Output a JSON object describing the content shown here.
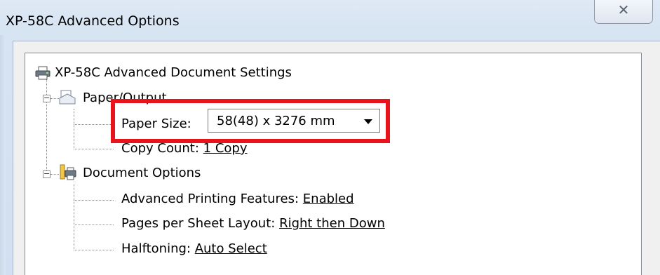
{
  "window": {
    "title": "XP-58C Advanced Options",
    "close_glyph": "✕"
  },
  "tree": {
    "root": {
      "label": "XP-58C Advanced Document Settings",
      "icon": "printer-icon"
    },
    "paper_output": {
      "label": "Paper/Output",
      "icon": "paper-output-icon",
      "expander": "−",
      "paper_size": {
        "label": "Paper Size:",
        "value": "58(48) x 3276 mm"
      },
      "copy_count": {
        "label": "Copy Count:",
        "value": "1 Copy"
      }
    },
    "document_options": {
      "label": "Document Options",
      "icon": "document-options-icon",
      "expander": "−",
      "advanced_printing": {
        "label": "Advanced Printing Features:",
        "value": "Enabled"
      },
      "pages_per_sheet": {
        "label": "Pages per Sheet Layout:",
        "value": "Right then Down"
      },
      "halftoning": {
        "label": "Halftoning:",
        "value": "Auto Select"
      }
    }
  },
  "colors": {
    "highlight": "#e8141c",
    "window_frame": "#d7e4f2"
  }
}
